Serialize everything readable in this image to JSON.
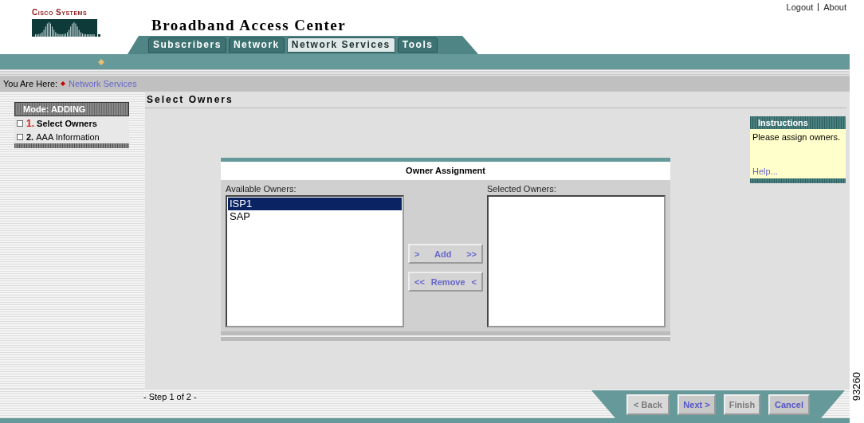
{
  "logo": {
    "text": "Cisco Systems"
  },
  "app_title": "Broadband Access Center",
  "top_links": [
    "Logout",
    "About"
  ],
  "tabs": [
    {
      "label": "Subscribers",
      "selected": false
    },
    {
      "label": "Network",
      "selected": false
    },
    {
      "label": "Network Services",
      "selected": true
    },
    {
      "label": "Tools",
      "selected": false
    }
  ],
  "breadcrumb": {
    "label": "You Are Here:",
    "items": [
      "Network Services"
    ]
  },
  "wizard": {
    "mode": "Mode: ADDING",
    "steps": [
      {
        "number": "1.",
        "label": "Select Owners",
        "selected": true
      },
      {
        "number": "2.",
        "label": "AAA Information",
        "selected": false
      }
    ]
  },
  "page_title": "Select Owners",
  "panel": {
    "title": "Owner Assignment",
    "available": {
      "label": "Available Owners:",
      "items": [
        {
          "label": "ISP1",
          "selected": true
        },
        {
          "label": "SAP",
          "selected": false
        }
      ]
    },
    "selected": {
      "label": "Selected Owners:"
    },
    "add_button": {
      "left": ">",
      "label": "Add",
      "right": ">>"
    },
    "remove_button": {
      "left": "<<",
      "label": "Remove",
      "right": "<"
    }
  },
  "instructions": {
    "title": "Instructions",
    "text": "Please assign owners.",
    "link": "Help..."
  },
  "footer": {
    "step": "- Step 1 of 2 -",
    "buttons": [
      {
        "label": "< Back",
        "disabled": true
      },
      {
        "label": "Next >",
        "disabled": false
      },
      {
        "label": "Finish",
        "disabled": true
      },
      {
        "label": "Cancel",
        "disabled": false
      }
    ]
  },
  "figure_id": "93260"
}
